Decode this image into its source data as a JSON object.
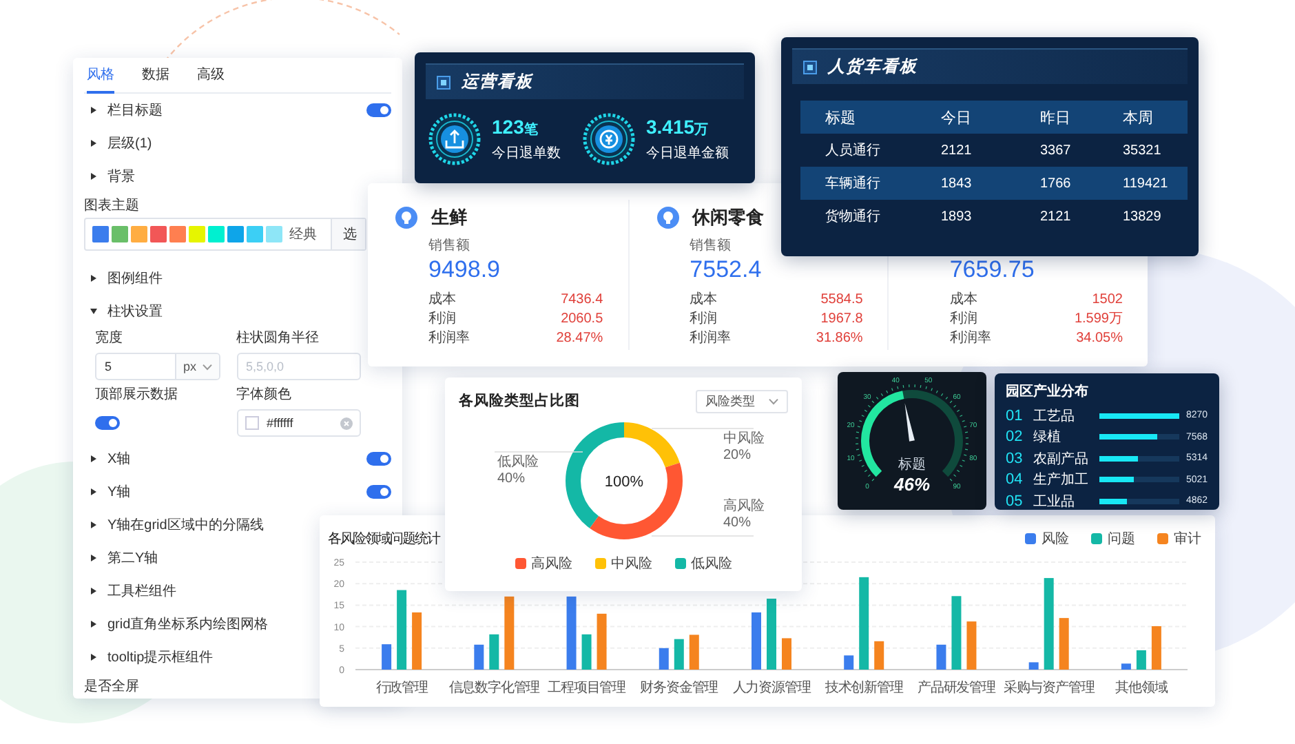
{
  "config_panel": {
    "tabs": [
      {
        "label": "风格",
        "selected": true
      },
      {
        "label": "数据",
        "selected": false
      },
      {
        "label": "高级",
        "selected": false
      }
    ],
    "items": [
      {
        "kind": "section",
        "label": "栏目标题",
        "expanded": false,
        "on": true
      },
      {
        "kind": "section",
        "label": "层级(1)",
        "expanded": false
      },
      {
        "kind": "section",
        "label": "背景",
        "expanded": false
      },
      {
        "kind": "theme",
        "label": "图表主题",
        "swatches": [
          {
            "color": "#3b7ded"
          },
          {
            "color": "#6abf69"
          },
          {
            "color": "#ffad42"
          },
          {
            "color": "#f25757"
          },
          {
            "color": "#ff7f50"
          },
          {
            "color": "#e6f500"
          },
          {
            "color": "#00f0d0"
          },
          {
            "color": "#0ea5e9"
          },
          {
            "color": "#3ccff5"
          },
          {
            "color": "#8ee6f7"
          }
        ],
        "name": "经典",
        "button": "选"
      },
      {
        "kind": "section",
        "label": "图例组件",
        "expanded": false
      },
      {
        "kind": "bar_settings",
        "label": "柱状设置",
        "expanded": true,
        "fields": [
          {
            "kind": "number_unit",
            "label": "宽度",
            "value": "5",
            "unit": "px"
          },
          {
            "kind": "text",
            "label": "柱状圆角半径",
            "placeholder": "5,5,0,0"
          },
          {
            "kind": "toggle",
            "label": "顶部展示数据",
            "on": true
          },
          {
            "kind": "color",
            "label": "字体颜色",
            "value": "#ffffff"
          }
        ]
      },
      {
        "kind": "section",
        "label": "X轴",
        "expanded": false,
        "on": true
      },
      {
        "kind": "section",
        "label": "Y轴",
        "expanded": false,
        "on": true
      },
      {
        "kind": "section",
        "label": "Y轴在grid区域中的分隔线",
        "expanded": false
      },
      {
        "kind": "section",
        "label": "第二Y轴",
        "expanded": false
      },
      {
        "kind": "section",
        "label": "工具栏组件",
        "expanded": false
      },
      {
        "kind": "section",
        "label": "grid直角坐标系内绘图网格",
        "expanded": false
      },
      {
        "kind": "section",
        "label": "tooltip提示框组件",
        "expanded": false
      },
      {
        "kind": "label",
        "label": "是否全屏"
      }
    ]
  },
  "ops_board": {
    "title": "运营看板",
    "stats": [
      {
        "kind": "inbox",
        "value": "123",
        "unit": "笔",
        "label": "今日退单数"
      },
      {
        "kind": "coin",
        "value": "3.415",
        "unit": "万",
        "label": "今日退单金额"
      }
    ]
  },
  "traffic_board": {
    "title": "人货车看板",
    "columns": [
      "标题",
      "今日",
      "昨日",
      "本周"
    ],
    "rows": [
      [
        "人员通行",
        "2121",
        "3367",
        "35321"
      ],
      [
        "车辆通行",
        "1843",
        "1766",
        "119421"
      ],
      [
        "货物通行",
        "1893",
        "2121",
        "13829"
      ]
    ]
  },
  "sales_card": {
    "groups": [
      {
        "title": "生鲜",
        "metric_label": "销售额",
        "value": "9498.9",
        "rows": [
          {
            "label": "成本",
            "value": "7436.4"
          },
          {
            "label": "利润",
            "value": "2060.5"
          },
          {
            "label": "利润率",
            "value": "28.47%"
          }
        ]
      },
      {
        "title": "休闲零食",
        "metric_label": "销售额",
        "value": "7552.4",
        "rows": [
          {
            "label": "成本",
            "value": "5584.5"
          },
          {
            "label": "利润",
            "value": "1967.8"
          },
          {
            "label": "利润率",
            "value": "31.86%"
          }
        ]
      },
      {
        "value": "7659.75",
        "rows": [
          {
            "label": "成本",
            "value": "1502"
          },
          {
            "label": "利润",
            "value": "1.599万"
          },
          {
            "label": "利润率",
            "value": "34.05%"
          }
        ]
      }
    ]
  },
  "risk_share_card": {
    "title": "各风险类型占比图",
    "dropdown": "风险类型",
    "center_label": "100%",
    "chart_data": {
      "type": "donut",
      "categories": [
        "中风险",
        "高风险",
        "低风险"
      ],
      "values": [
        20,
        40,
        40
      ],
      "colors": [
        "#ffc107",
        "#ff5733",
        "#14b8a6"
      ],
      "value_labels": [
        "20%",
        "40%",
        "40%"
      ]
    },
    "legend": [
      {
        "label": "高风险",
        "color": "#ff5733"
      },
      {
        "label": "中风险",
        "color": "#ffc107"
      },
      {
        "label": "低风险",
        "color": "#14b8a6"
      }
    ]
  },
  "gauge_card": {
    "title": "标题",
    "reading": "46%",
    "level": 0.46,
    "ticks": [
      "0",
      "10",
      "20",
      "30",
      "40",
      "50",
      "60",
      "70",
      "80",
      "90"
    ]
  },
  "park_card": {
    "title": "园区产业分布",
    "items": [
      {
        "rank": "01",
        "name": "工艺品",
        "value": "8270",
        "level": 1.0
      },
      {
        "rank": "02",
        "name": "绿植",
        "value": "7568",
        "level": 0.72
      },
      {
        "rank": "03",
        "name": "农副产品",
        "value": "5314",
        "level": 0.48
      },
      {
        "rank": "04",
        "name": "生产加工",
        "value": "5021",
        "level": 0.43
      },
      {
        "rank": "05",
        "name": "工业品",
        "value": "4862",
        "level": 0.35
      }
    ]
  },
  "risk_stats_card": {
    "title": "各风险领域问题统计",
    "chart_data": {
      "type": "bar",
      "categories": [
        "行政管理",
        "信息数字化管理",
        "工程项目管理",
        "财务资金管理",
        "人力资源管理",
        "技术创新管理",
        "产品研发管理",
        "采购与资产管理",
        "其他领域"
      ],
      "series": [
        {
          "name": "风险",
          "color": "#3b7ded",
          "values": [
            5.9,
            5.8,
            17,
            5,
            13.3,
            3.3,
            5.8,
            1.7,
            1.4
          ]
        },
        {
          "name": "问题",
          "color": "#14b8a6",
          "values": [
            18.5,
            8.2,
            8.2,
            7.1,
            16.5,
            21.5,
            17.1,
            21.3,
            4.5
          ]
        },
        {
          "name": "审计",
          "color": "#f5841f",
          "values": [
            13.3,
            17,
            13,
            8.1,
            7.3,
            6.6,
            11.2,
            12,
            10.1
          ]
        }
      ],
      "ylim": [
        0,
        25
      ],
      "yticks": [
        0,
        5,
        10,
        15,
        20,
        25
      ],
      "grid": true
    }
  }
}
